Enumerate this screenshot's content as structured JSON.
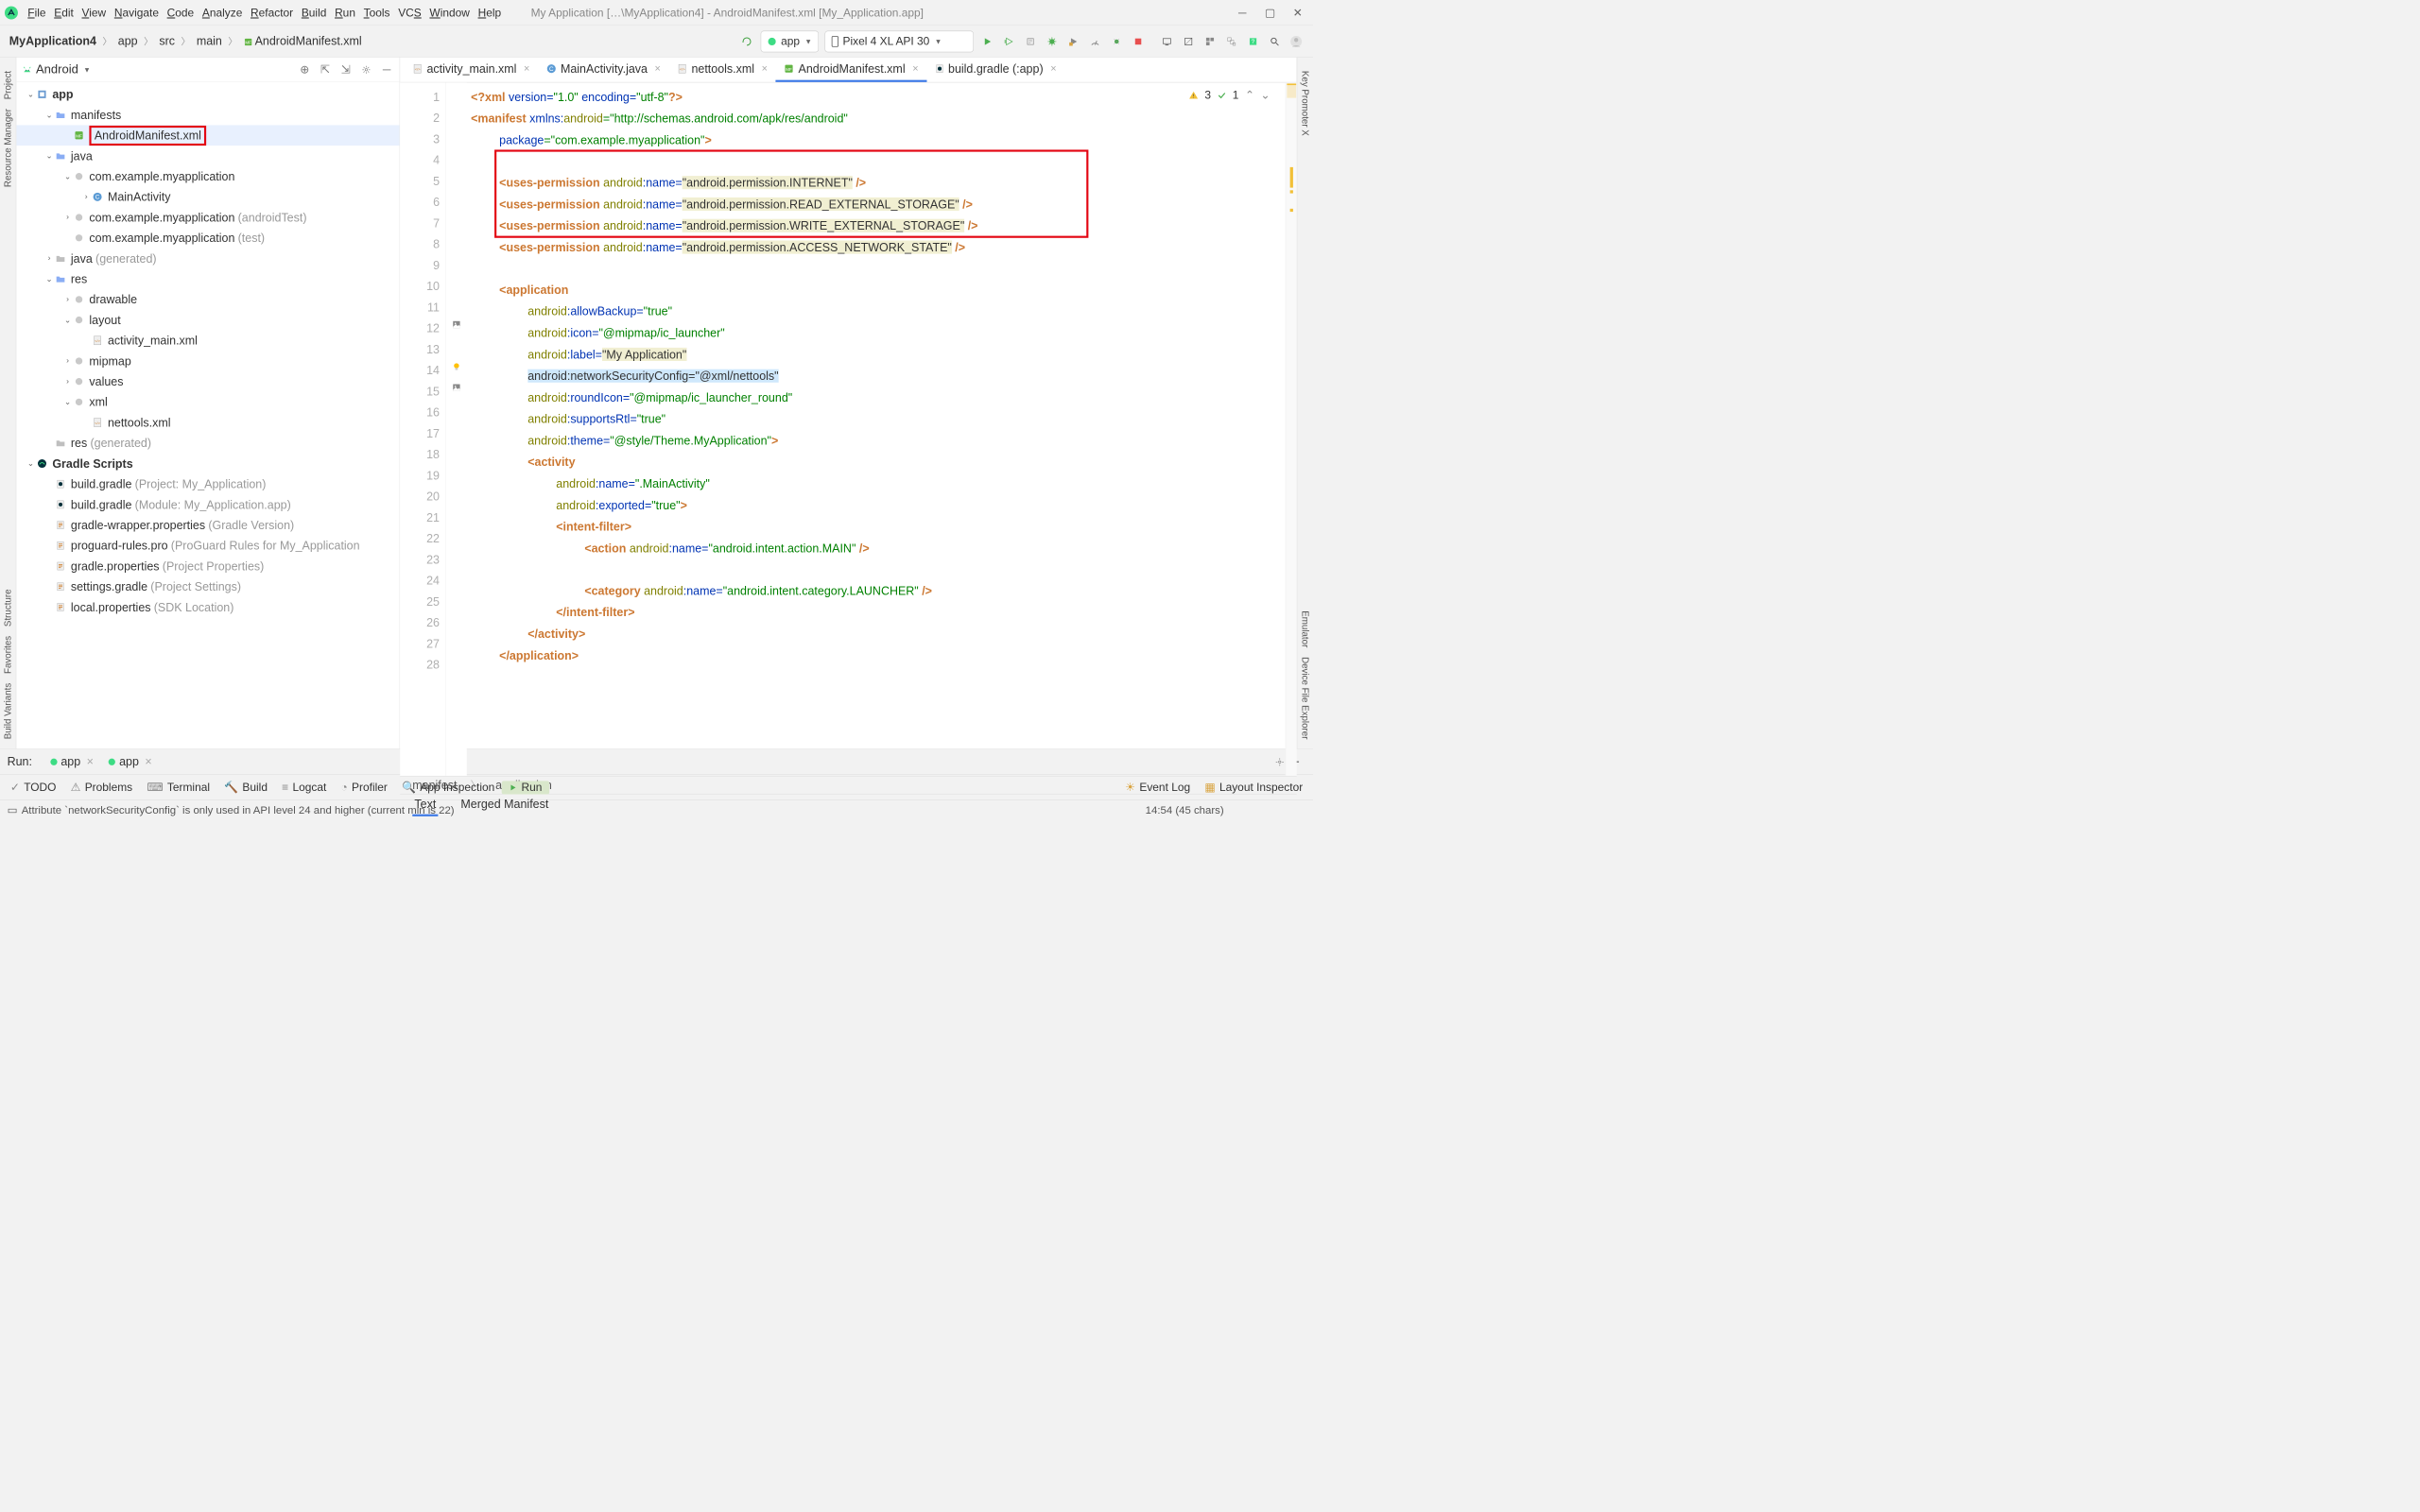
{
  "menubar": {
    "items": [
      {
        "label": "File",
        "u": 0
      },
      {
        "label": "Edit",
        "u": 0
      },
      {
        "label": "View",
        "u": 0
      },
      {
        "label": "Navigate",
        "u": 0
      },
      {
        "label": "Code",
        "u": 0
      },
      {
        "label": "Analyze",
        "u": 0
      },
      {
        "label": "Refactor",
        "u": 0
      },
      {
        "label": "Build",
        "u": 0
      },
      {
        "label": "Run",
        "u": 0
      },
      {
        "label": "Tools",
        "u": 0
      },
      {
        "label": "VCS",
        "u": 2
      },
      {
        "label": "Window",
        "u": 0
      },
      {
        "label": "Help",
        "u": 0
      }
    ],
    "title": "My Application […\\MyApplication4] - AndroidManifest.xml [My_Application.app]"
  },
  "breadcrumb": [
    "MyApplication4",
    "app",
    "src",
    "main",
    "AndroidManifest.xml"
  ],
  "toolbar": {
    "config_label": "app",
    "device_label": "Pixel 4 XL API 30"
  },
  "project": {
    "view_label": "Android"
  },
  "tree": [
    {
      "depth": 0,
      "exp": "open",
      "icon": "module",
      "label": "app",
      "bold": true
    },
    {
      "depth": 1,
      "exp": "open",
      "icon": "folder",
      "label": "manifests"
    },
    {
      "depth": 2,
      "exp": "none",
      "icon": "manifest",
      "label": "AndroidManifest.xml",
      "selected": true,
      "redbox": true
    },
    {
      "depth": 1,
      "exp": "open",
      "icon": "folder",
      "label": "java"
    },
    {
      "depth": 2,
      "exp": "open",
      "icon": "package",
      "label": "com.example.myapplication"
    },
    {
      "depth": 3,
      "exp": "closed",
      "icon": "class",
      "label": "MainActivity"
    },
    {
      "depth": 2,
      "exp": "closed",
      "icon": "package",
      "label": "com.example.myapplication",
      "muted": "(androidTest)"
    },
    {
      "depth": 2,
      "exp": "none",
      "icon": "package",
      "label": "com.example.myapplication",
      "muted": "(test)"
    },
    {
      "depth": 1,
      "exp": "closed",
      "icon": "folder-gray",
      "label": "java",
      "muted": "(generated)"
    },
    {
      "depth": 1,
      "exp": "open",
      "icon": "folder",
      "label": "res"
    },
    {
      "depth": 2,
      "exp": "closed",
      "icon": "package",
      "label": "drawable"
    },
    {
      "depth": 2,
      "exp": "open",
      "icon": "package",
      "label": "layout"
    },
    {
      "depth": 3,
      "exp": "none",
      "icon": "xml",
      "label": "activity_main.xml"
    },
    {
      "depth": 2,
      "exp": "closed",
      "icon": "package",
      "label": "mipmap"
    },
    {
      "depth": 2,
      "exp": "closed",
      "icon": "package",
      "label": "values"
    },
    {
      "depth": 2,
      "exp": "open",
      "icon": "package",
      "label": "xml"
    },
    {
      "depth": 3,
      "exp": "none",
      "icon": "xml",
      "label": "nettools.xml"
    },
    {
      "depth": 1,
      "exp": "none",
      "icon": "folder-gray",
      "label": "res",
      "muted": "(generated)"
    },
    {
      "depth": 0,
      "exp": "open",
      "icon": "gradle",
      "label": "Gradle Scripts",
      "bold": true
    },
    {
      "depth": 1,
      "exp": "none",
      "icon": "gradle-file",
      "label": "build.gradle",
      "muted": "(Project: My_Application)"
    },
    {
      "depth": 1,
      "exp": "none",
      "icon": "gradle-file",
      "label": "build.gradle",
      "muted": "(Module: My_Application.app)"
    },
    {
      "depth": 1,
      "exp": "none",
      "icon": "prop",
      "label": "gradle-wrapper.properties",
      "muted": "(Gradle Version)"
    },
    {
      "depth": 1,
      "exp": "none",
      "icon": "prop",
      "label": "proguard-rules.pro",
      "muted": "(ProGuard Rules for My_Application"
    },
    {
      "depth": 1,
      "exp": "none",
      "icon": "prop",
      "label": "gradle.properties",
      "muted": "(Project Properties)"
    },
    {
      "depth": 1,
      "exp": "none",
      "icon": "prop",
      "label": "settings.gradle",
      "muted": "(Project Settings)"
    },
    {
      "depth": 1,
      "exp": "none",
      "icon": "prop",
      "label": "local.properties",
      "muted": "(SDK Location)"
    }
  ],
  "tabs": [
    {
      "icon": "xml",
      "label": "activity_main.xml"
    },
    {
      "icon": "class",
      "label": "MainActivity.java"
    },
    {
      "icon": "xml",
      "label": "nettools.xml"
    },
    {
      "icon": "manifest",
      "label": "AndroidManifest.xml",
      "active": true
    },
    {
      "icon": "gradle-file",
      "label": "build.gradle (:app)"
    }
  ],
  "inspect": {
    "warnings": "3",
    "ok": "1"
  },
  "code_lines": [
    {
      "n": 1,
      "tokens": [
        [
          "orange",
          "<?xml "
        ],
        [
          "blue",
          "version="
        ],
        [
          "green",
          "\"1.0\" "
        ],
        [
          "blue",
          "encoding="
        ],
        [
          "green",
          "\"utf-8\""
        ],
        [
          "orange",
          "?>"
        ]
      ],
      "indent": 0
    },
    {
      "n": 2,
      "indent": 0,
      "tokens": [
        [
          "orange",
          "<manifest "
        ],
        [
          "blue",
          "xmlns:"
        ],
        [
          "olive",
          "android"
        ],
        [
          "green",
          "=\"http://schemas.android.com/apk/res/android\""
        ]
      ]
    },
    {
      "n": 3,
      "indent": 1,
      "tokens": [
        [
          "blue",
          "package"
        ],
        [
          "green",
          "=\"com.example.myapplication\""
        ],
        [
          "orange",
          ">"
        ]
      ]
    },
    {
      "n": 4,
      "indent": 0,
      "tokens": []
    },
    {
      "n": 5,
      "indent": 1,
      "tokens": [
        [
          "orange",
          "<uses-permission "
        ],
        [
          "olive",
          "android"
        ],
        [
          "blue",
          ":name="
        ],
        [
          "hilite",
          "\"android.permission.INTERNET\""
        ],
        [
          "orange",
          " />"
        ]
      ]
    },
    {
      "n": 6,
      "indent": 1,
      "tokens": [
        [
          "orange",
          "<uses-permission "
        ],
        [
          "olive",
          "android"
        ],
        [
          "blue",
          ":name="
        ],
        [
          "hilite",
          "\"android.permission.READ_EXTERNAL_STORAGE\""
        ],
        [
          "orange",
          " />"
        ]
      ]
    },
    {
      "n": 7,
      "indent": 1,
      "tokens": [
        [
          "orange",
          "<uses-permission "
        ],
        [
          "olive",
          "android"
        ],
        [
          "blue",
          ":name="
        ],
        [
          "hilite",
          "\"android.permission.WRITE_EXTERNAL_STORAGE\""
        ],
        [
          "orange",
          " />"
        ]
      ]
    },
    {
      "n": 8,
      "indent": 1,
      "tokens": [
        [
          "orange",
          "<uses-permission "
        ],
        [
          "olive",
          "android"
        ],
        [
          "blue",
          ":name="
        ],
        [
          "hilite",
          "\"android.permission.ACCESS_NETWORK_STATE\""
        ],
        [
          "orange",
          " />"
        ]
      ]
    },
    {
      "n": 9,
      "indent": 0,
      "tokens": []
    },
    {
      "n": 10,
      "indent": 1,
      "tokens": [
        [
          "orange",
          "<application"
        ]
      ]
    },
    {
      "n": 11,
      "indent": 2,
      "tokens": [
        [
          "olive",
          "android"
        ],
        [
          "blue",
          ":allowBackup="
        ],
        [
          "green",
          "\"true\""
        ]
      ]
    },
    {
      "n": 12,
      "indent": 2,
      "tokens": [
        [
          "olive",
          "android"
        ],
        [
          "blue",
          ":icon="
        ],
        [
          "green",
          "\"@mipmap/ic_launcher\""
        ]
      ],
      "gicon": "image"
    },
    {
      "n": 13,
      "indent": 2,
      "tokens": [
        [
          "olive",
          "android"
        ],
        [
          "blue",
          ":label="
        ],
        [
          "hilite",
          "\"My Application\""
        ]
      ]
    },
    {
      "n": 14,
      "indent": 2,
      "sel": true,
      "tokens": [
        [
          "selline",
          "android:networkSecurityConfig=\"@xml/nettools\""
        ]
      ],
      "bulb": true
    },
    {
      "n": 15,
      "indent": 2,
      "tokens": [
        [
          "olive",
          "android"
        ],
        [
          "blue",
          ":roundIcon="
        ],
        [
          "green",
          "\"@mipmap/ic_launcher_round\""
        ]
      ],
      "gicon": "image"
    },
    {
      "n": 16,
      "indent": 2,
      "tokens": [
        [
          "olive",
          "android"
        ],
        [
          "blue",
          ":supportsRtl="
        ],
        [
          "green",
          "\"true\""
        ]
      ]
    },
    {
      "n": 17,
      "indent": 2,
      "tokens": [
        [
          "olive",
          "android"
        ],
        [
          "blue",
          ":theme="
        ],
        [
          "green",
          "\"@style/Theme.MyApplication\""
        ],
        [
          "orange",
          ">"
        ]
      ]
    },
    {
      "n": 18,
      "indent": 2,
      "tokens": [
        [
          "orange",
          "<activity"
        ]
      ]
    },
    {
      "n": 19,
      "indent": 3,
      "tokens": [
        [
          "olive",
          "android"
        ],
        [
          "blue",
          ":name="
        ],
        [
          "green",
          "\".MainActivity\""
        ]
      ]
    },
    {
      "n": 20,
      "indent": 3,
      "tokens": [
        [
          "olive",
          "android"
        ],
        [
          "blue",
          ":exported="
        ],
        [
          "green",
          "\"true\""
        ],
        [
          "orange",
          ">"
        ]
      ]
    },
    {
      "n": 21,
      "indent": 3,
      "tokens": [
        [
          "orange",
          "<intent-filter>"
        ]
      ]
    },
    {
      "n": 22,
      "indent": 4,
      "tokens": [
        [
          "orange",
          "<action "
        ],
        [
          "olive",
          "android"
        ],
        [
          "blue",
          ":name="
        ],
        [
          "green",
          "\"android.intent.action.MAIN\""
        ],
        [
          "orange",
          " />"
        ]
      ]
    },
    {
      "n": 23,
      "indent": 0,
      "tokens": []
    },
    {
      "n": 24,
      "indent": 4,
      "tokens": [
        [
          "orange",
          "<category "
        ],
        [
          "olive",
          "android"
        ],
        [
          "blue",
          ":name="
        ],
        [
          "green",
          "\"android.intent.category.LAUNCHER\""
        ],
        [
          "orange",
          " />"
        ]
      ]
    },
    {
      "n": 25,
      "indent": 3,
      "tokens": [
        [
          "orange",
          "</intent-filter>"
        ]
      ]
    },
    {
      "n": 26,
      "indent": 2,
      "tokens": [
        [
          "orange",
          "</activity>"
        ]
      ]
    },
    {
      "n": 27,
      "indent": 1,
      "tokens": [
        [
          "orange",
          "</application>"
        ]
      ]
    },
    {
      "n": 28,
      "indent": 0,
      "tokens": []
    }
  ],
  "editor_breadcrumb": [
    "manifest",
    "application"
  ],
  "editor_footer_tabs": [
    "Text",
    "Merged Manifest"
  ],
  "left_rail": [
    "Project",
    "Resource Manager"
  ],
  "left_rail_bottom": [
    "Structure",
    "Favorites",
    "Build Variants"
  ],
  "right_rail": [
    "Key Promoter X"
  ],
  "right_rail_bottom": [
    "Emulator",
    "Device File Explorer"
  ],
  "run_panel": {
    "label": "Run:",
    "tabs": [
      "app",
      "app"
    ]
  },
  "bottombar": {
    "items": [
      {
        "icon": "todo",
        "label": "TODO"
      },
      {
        "icon": "problems",
        "label": "Problems"
      },
      {
        "icon": "terminal",
        "label": "Terminal"
      },
      {
        "icon": "build",
        "label": "Build"
      },
      {
        "icon": "logcat",
        "label": "Logcat"
      },
      {
        "icon": "profiler",
        "label": "Profiler"
      },
      {
        "icon": "appinspect",
        "label": "App Inspection"
      },
      {
        "icon": "run",
        "label": "Run",
        "active": true
      }
    ],
    "right": [
      {
        "icon": "event",
        "label": "Event Log"
      },
      {
        "icon": "layout",
        "label": "Layout Inspector"
      }
    ]
  },
  "statusbar": {
    "msg": "Attribute `networkSecurityConfig` is only used in API level 24 and higher (current min is 22)",
    "pos": "14:54 (45 chars)"
  }
}
